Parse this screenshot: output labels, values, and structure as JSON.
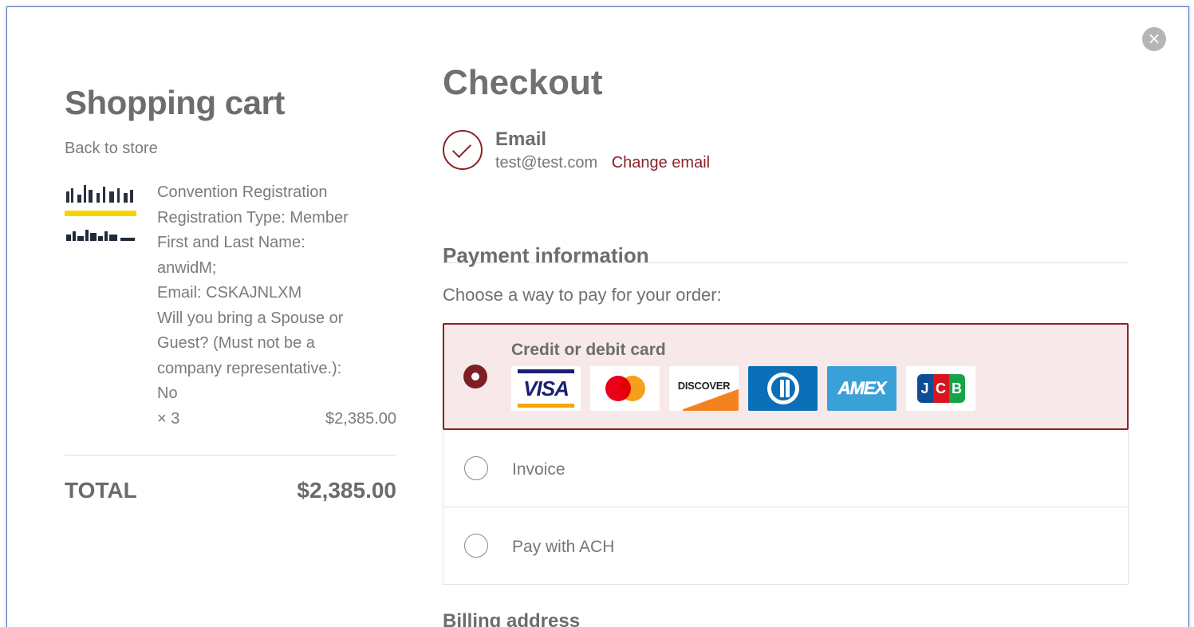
{
  "close": {
    "glyph": "×"
  },
  "cart": {
    "title": "Shopping cart",
    "back_link": "Back to store",
    "item": {
      "thumb_alt_text": "IPCA Annual Convention Registration",
      "lines": [
        "Convention Registration",
        "Registration Type: Member",
        "First and Last Name:",
        "anwidM;",
        "Email: CSKAJNLXM",
        "Will you bring a Spouse or",
        "Guest? (Must not be a",
        "company representative.):",
        "No"
      ],
      "qty": "× 3",
      "price": "$2,385.00"
    },
    "total_label": "TOTAL",
    "total_value": "$2,385.00"
  },
  "checkout": {
    "title": "Checkout",
    "email": {
      "label": "Email",
      "value": "test@test.com",
      "change_link": "Change email"
    },
    "payment": {
      "title": "Payment information",
      "subtitle": "Choose a way to pay for your order:",
      "options": [
        {
          "label": "Credit or debit card",
          "selected": true
        },
        {
          "label": "Invoice",
          "selected": false
        },
        {
          "label": "Pay with ACH",
          "selected": false
        }
      ],
      "cards": {
        "visa": "VISA",
        "discover": "DISCOVER",
        "amex": "AMEX",
        "jcb": [
          "J",
          "C",
          "B"
        ]
      }
    },
    "billing_title": "Billing address"
  },
  "colors": {
    "accent": "#8b2227",
    "selected_bg": "#f7e9e9",
    "frame_border": "#4a73b8"
  }
}
